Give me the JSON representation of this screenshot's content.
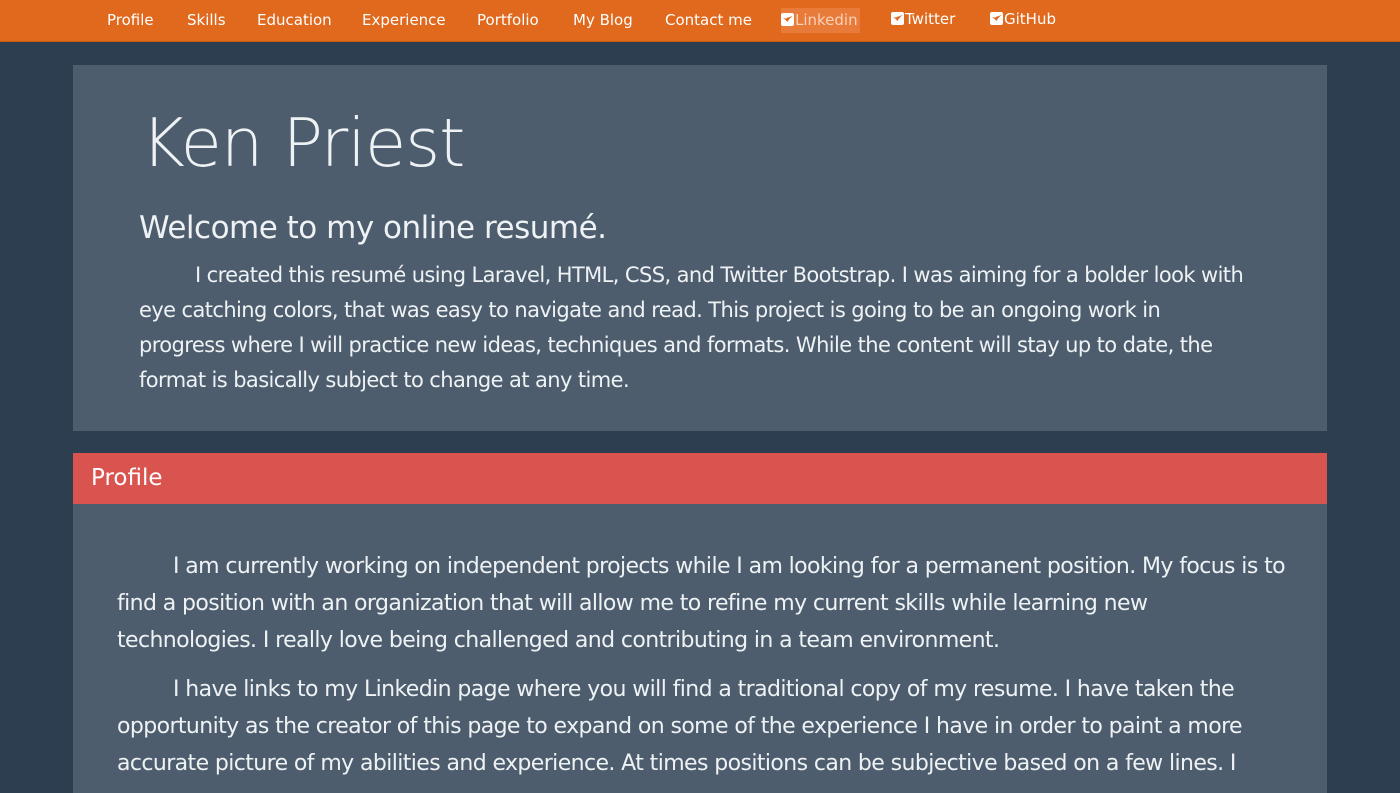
{
  "nav": {
    "items": [
      {
        "label": "Profile"
      },
      {
        "label": "Skills"
      },
      {
        "label": "Education"
      },
      {
        "label": "Experience"
      },
      {
        "label": "Portfolio"
      },
      {
        "label": "My Blog"
      },
      {
        "label": "Contact me"
      }
    ],
    "social": [
      {
        "label": "Linkedin",
        "icon": "linkedin-square-icon"
      },
      {
        "label": "Twitter",
        "icon": "twitter-square-icon"
      },
      {
        "label": "GitHub",
        "icon": "github-square-icon"
      }
    ]
  },
  "hero": {
    "name": "Ken Priest",
    "subtitle": "Welcome to my online resumé.",
    "intro": "I created this resumé using Laravel, HTML, CSS, and Twitter Bootstrap. I was aiming for a bolder look with eye catching colors, that was easy to navigate and read. This project is going to be an ongoing work in progress where I will practice new ideas, techniques and formats. While the content will stay up to date, the format is basically subject to change at any time."
  },
  "profile": {
    "title": "Profile",
    "paragraphs": [
      "I am currently working on independent projects while I am looking for a permanent position. My focus is to find a position with an organization that will allow me to refine my current skills while learning new technologies. I really love being challenged and contributing in a team environment.",
      "I have links to my Linkedin page where you will find a traditional copy of my resume. I have taken the opportunity as the creator of this page to expand on some of the experience I have in order to paint a more accurate picture of my abilities and experience. At times positions can be subjective based on a few lines. I"
    ]
  },
  "colors": {
    "navbar": "#e0691d",
    "page_background": "#2c3e50",
    "panel_background": "#4d5d6d",
    "section_header": "#d9534f",
    "text": "#eef2f4"
  }
}
